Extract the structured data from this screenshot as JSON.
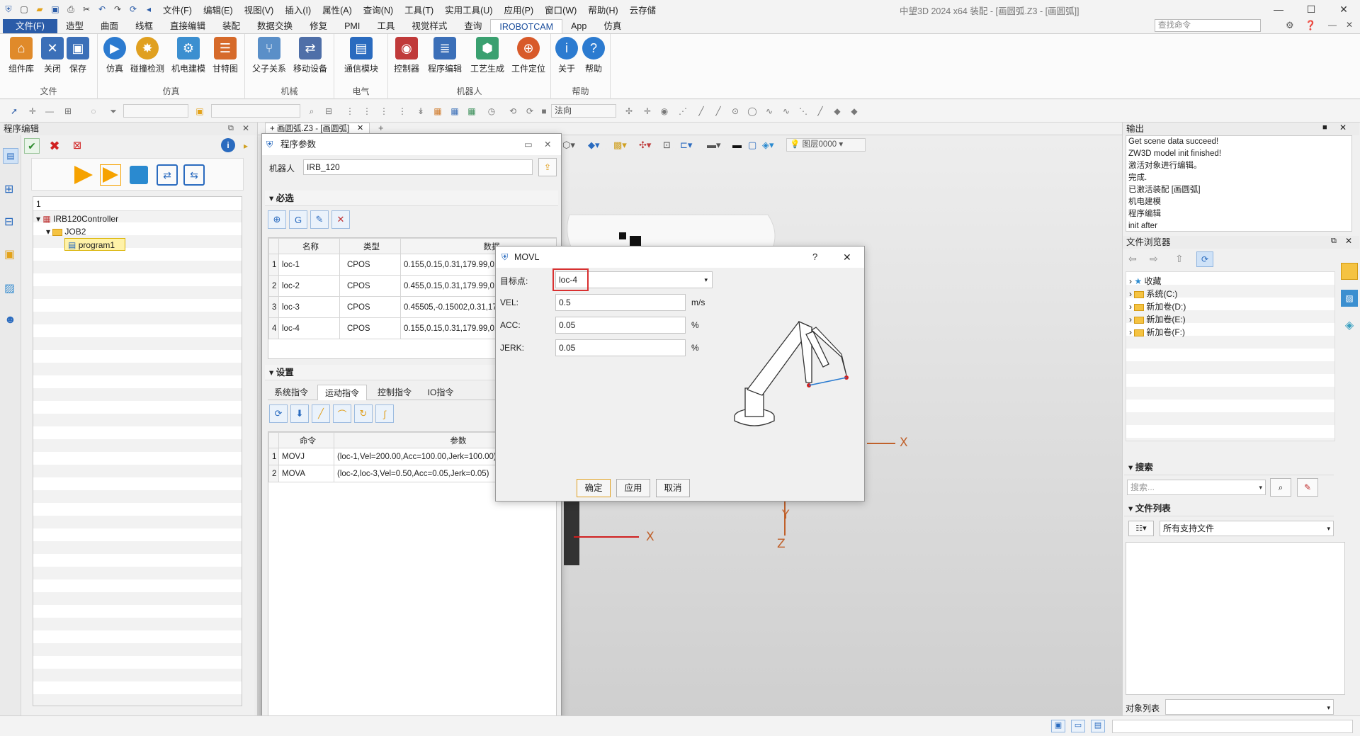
{
  "titlebar": {
    "menus": [
      "文件(F)",
      "编辑(E)",
      "视图(V)",
      "插入(I)",
      "属性(A)",
      "查询(N)",
      "工具(T)",
      "实用工具(U)",
      "应用(P)",
      "窗口(W)",
      "帮助(H)",
      "云存储"
    ],
    "title": "中望3D 2024 x64           装配 - [画圆弧.Z3 - [画圆弧]]"
  },
  "ribbon_tabs": [
    "文件(F)",
    "造型",
    "曲面",
    "线框",
    "直接编辑",
    "装配",
    "数据交换",
    "修复",
    "PMI",
    "工具",
    "视觉样式",
    "查询",
    "IROBOTCAM",
    "App",
    "仿真"
  ],
  "search_command_placeholder": "查找命令",
  "ribbon": {
    "groups": [
      {
        "label": "文件",
        "buttons": [
          "组件库",
          "关闭",
          "保存"
        ]
      },
      {
        "label": "仿真",
        "buttons": [
          "仿真",
          "碰撞检测",
          "机电建模",
          "甘特图"
        ]
      },
      {
        "label": "机械",
        "buttons": [
          "父子关系",
          "移动设备"
        ]
      },
      {
        "label": "电气",
        "buttons": [
          "通信模块"
        ]
      },
      {
        "label": "机器人",
        "buttons": [
          "控制器",
          "程序编辑",
          "工艺生成",
          "工件定位"
        ]
      },
      {
        "label": "帮助",
        "buttons": [
          "关于",
          "帮助"
        ]
      }
    ]
  },
  "toolbar": {
    "direction_combo": "法向",
    "layer_combo": "图层0000"
  },
  "left_panel": {
    "title": "程序编辑",
    "count": "1",
    "tree": {
      "controller": "IRB120Controller",
      "job": "JOB2",
      "program": "program1"
    }
  },
  "doc_tab": "画圆弧.Z3 - [画圆弧]",
  "program_params": {
    "title": "程序参数",
    "robot_label": "机器人",
    "robot_value": "IRB_120",
    "required_section": "必选",
    "table1_headers": [
      "名称",
      "类型",
      "数据"
    ],
    "table1_rows": [
      {
        "idx": "1",
        "name": "loc-1",
        "type": "CPOS",
        "data": "0.155,0.15,0.31,179.99,0.0"
      },
      {
        "idx": "2",
        "name": "loc-2",
        "type": "CPOS",
        "data": "0.455,0.15,0.31,179.99,0.0"
      },
      {
        "idx": "3",
        "name": "loc-3",
        "type": "CPOS",
        "data": "0.45505,-0.15002,0.31,17"
      },
      {
        "idx": "4",
        "name": "loc-4",
        "type": "CPOS",
        "data": "0.155,0.15,0.31,179.99,0.0"
      }
    ],
    "settings_section": "设置",
    "subtabs": [
      "系统指令",
      "运动指令",
      "控制指令",
      "IO指令"
    ],
    "table2_headers": [
      "命令",
      "参数"
    ],
    "table2_rows": [
      {
        "idx": "1",
        "cmd": "MOVJ",
        "params": "(loc-1,Vel=200.00,Acc=100.00,Jerk=100.00)"
      },
      {
        "idx": "2",
        "cmd": "MOVA",
        "params": "(loc-2,loc-3,Vel=0.50,Acc=0.05,Jerk=0.05)"
      }
    ]
  },
  "movl": {
    "title": "MOVL",
    "help": "?",
    "close": "✕",
    "target_label": "目标点:",
    "target_value": "loc-4",
    "vel_label": "VEL:",
    "vel_value": "0.5",
    "vel_unit": "m/s",
    "acc_label": "ACC:",
    "acc_value": "0.05",
    "acc_unit": "%",
    "jerk_label": "JERK:",
    "jerk_value": "0.05",
    "jerk_unit": "%",
    "ok": "确定",
    "apply": "应用",
    "cancel": "取消",
    "highlight_color": "#d93030"
  },
  "viewport": {
    "axis_labels": [
      "X",
      "X",
      "X",
      "Y",
      "Z"
    ]
  },
  "output": {
    "title": "输出",
    "lines": [
      "Get scene data succeed!",
      "ZW3D model init finished!",
      "激活对象进行编辑。",
      "完成.",
      "已激活装配 [画圆弧]",
      "机电建模",
      "程序编辑",
      "init after"
    ]
  },
  "file_browser": {
    "title": "文件浏览器",
    "items": [
      "收藏",
      "系统(C:)",
      "新加卷(D:)",
      "新加卷(E:)",
      "新加卷(F:)"
    ]
  },
  "search_section": {
    "title": "搜索",
    "placeholder": "搜索..."
  },
  "file_list": {
    "title": "文件列表",
    "filter": "所有支持文件"
  },
  "object_list_label": "对象列表"
}
